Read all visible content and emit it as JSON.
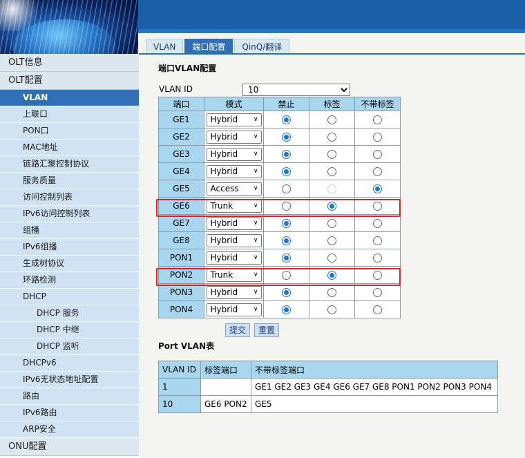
{
  "sidebar": {
    "items": [
      {
        "label": "OLT信息",
        "level": "top"
      },
      {
        "label": "OLT配置",
        "level": "top"
      },
      {
        "label": "VLAN",
        "level": "sub",
        "active": true
      },
      {
        "label": "上联口",
        "level": "sub"
      },
      {
        "label": "PON口",
        "level": "sub"
      },
      {
        "label": "MAC地址",
        "level": "sub"
      },
      {
        "label": "链路汇聚控制协议",
        "level": "sub"
      },
      {
        "label": "服务质量",
        "level": "sub"
      },
      {
        "label": "访问控制列表",
        "level": "sub"
      },
      {
        "label": "IPv6访问控制列表",
        "level": "sub"
      },
      {
        "label": "组播",
        "level": "sub"
      },
      {
        "label": "IPv6组播",
        "level": "sub"
      },
      {
        "label": "生成树协议",
        "level": "sub"
      },
      {
        "label": "环路检测",
        "level": "sub"
      },
      {
        "label": "DHCP",
        "level": "sub"
      },
      {
        "label": "DHCP 服务",
        "level": "sub2"
      },
      {
        "label": "DHCP 中继",
        "level": "sub2"
      },
      {
        "label": "DHCP 监听",
        "level": "sub2"
      },
      {
        "label": "DHCPv6",
        "level": "sub"
      },
      {
        "label": "IPv6无状态地址配置",
        "level": "sub"
      },
      {
        "label": "路由",
        "level": "sub"
      },
      {
        "label": "IPv6路由",
        "level": "sub"
      },
      {
        "label": "ARP安全",
        "level": "sub"
      },
      {
        "label": "ONU配置",
        "level": "top"
      }
    ]
  },
  "tabs": [
    {
      "label": "VLAN",
      "active": false
    },
    {
      "label": "端口配置",
      "active": true
    },
    {
      "label": "QinQ/翻译",
      "active": false
    }
  ],
  "port_vlan_config": {
    "title": "端口VLAN配置",
    "vlan_id_label": "VLAN ID",
    "vlan_id_value": "10",
    "columns": [
      "端口",
      "模式",
      "禁止",
      "标签",
      "不带标签"
    ],
    "rows": [
      {
        "port": "GE1",
        "mode": "Hybrid",
        "selected": "forbid"
      },
      {
        "port": "GE2",
        "mode": "Hybrid",
        "selected": "forbid"
      },
      {
        "port": "GE3",
        "mode": "Hybrid",
        "selected": "forbid"
      },
      {
        "port": "GE4",
        "mode": "Hybrid",
        "selected": "forbid"
      },
      {
        "port": "GE5",
        "mode": "Access",
        "selected": "untagged",
        "tagged_disabled": true
      },
      {
        "port": "GE6",
        "mode": "Trunk",
        "selected": "tagged",
        "highlighted": true
      },
      {
        "port": "GE7",
        "mode": "Hybrid",
        "selected": "forbid"
      },
      {
        "port": "GE8",
        "mode": "Hybrid",
        "selected": "forbid"
      },
      {
        "port": "PON1",
        "mode": "Hybrid",
        "selected": "forbid"
      },
      {
        "port": "PON2",
        "mode": "Trunk",
        "selected": "tagged",
        "highlighted": true
      },
      {
        "port": "PON3",
        "mode": "Hybrid",
        "selected": "forbid"
      },
      {
        "port": "PON4",
        "mode": "Hybrid",
        "selected": "forbid"
      }
    ],
    "submit_label": "提交",
    "reset_label": "重置",
    "highlight_color": "#e02020"
  },
  "port_vlan_table": {
    "title": "Port VLAN表",
    "columns": [
      "VLAN ID",
      "标签端口",
      "不带标签端口"
    ],
    "rows": [
      [
        "1",
        "",
        "GE1 GE2 GE3 GE4 GE6 GE7 GE8 PON1 PON2 PON3 PON4"
      ],
      [
        "10",
        "GE6 PON2",
        "GE5"
      ]
    ]
  },
  "colors": {
    "header_blue": "#1a5fa8",
    "active_blue": "#2f6fb6",
    "cell_blue": "#a9d6ef",
    "sidebar_bg": "#cfe3f3"
  }
}
